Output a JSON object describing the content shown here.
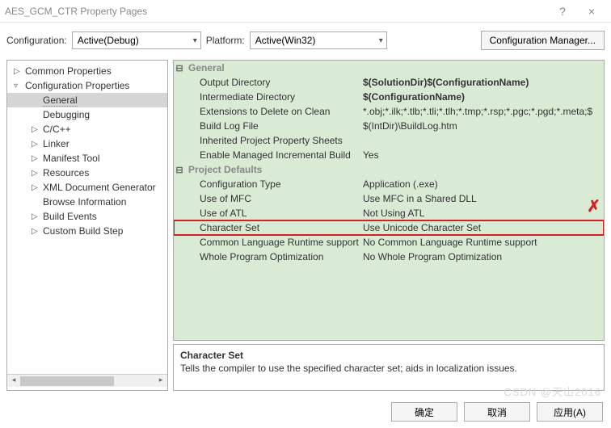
{
  "window": {
    "title": "AES_GCM_CTR Property Pages",
    "help": "?",
    "close": "×"
  },
  "topbar": {
    "config_label": "Configuration:",
    "config_value": "Active(Debug)",
    "platform_label": "Platform:",
    "platform_value": "Active(Win32)",
    "manager": "Configuration Manager..."
  },
  "tree": {
    "root1": "Common Properties",
    "root2": "Configuration Properties",
    "items": [
      "General",
      "Debugging",
      "C/C++",
      "Linker",
      "Manifest Tool",
      "Resources",
      "XML Document Generator",
      "Browse Information",
      "Build Events",
      "Custom Build Step"
    ]
  },
  "grid": {
    "section1": "General",
    "rows1": [
      {
        "k": "Output Directory",
        "v": "$(SolutionDir)$(ConfigurationName)",
        "bold": true
      },
      {
        "k": "Intermediate Directory",
        "v": "$(ConfigurationName)",
        "bold": true
      },
      {
        "k": "Extensions to Delete on Clean",
        "v": "*.obj;*.ilk;*.tlb;*.tli;*.tlh;*.tmp;*.rsp;*.pgc;*.pgd;*.meta;$"
      },
      {
        "k": "Build Log File",
        "v": "$(IntDir)\\BuildLog.htm"
      },
      {
        "k": "Inherited Project Property Sheets",
        "v": ""
      },
      {
        "k": "Enable Managed Incremental Build",
        "v": "Yes"
      }
    ],
    "section2": "Project Defaults",
    "rows2": [
      {
        "k": "Configuration Type",
        "v": "Application (.exe)"
      },
      {
        "k": "Use of MFC",
        "v": "Use MFC in a Shared DLL"
      },
      {
        "k": "Use of ATL",
        "v": "Not Using ATL"
      },
      {
        "k": "Character Set",
        "v": "Use Unicode Character Set",
        "sel": true
      },
      {
        "k": "Common Language Runtime support",
        "v": "No Common Language Runtime support"
      },
      {
        "k": "Whole Program Optimization",
        "v": "No Whole Program Optimization"
      }
    ]
  },
  "desc": {
    "title": "Character Set",
    "text": "Tells the compiler to use the specified character set; aids in localization issues."
  },
  "footer": {
    "ok": "确定",
    "cancel": "取消",
    "apply": "应用(A)"
  },
  "annotation": {
    "x": "✗"
  },
  "watermark": "CSDN @天山2016"
}
